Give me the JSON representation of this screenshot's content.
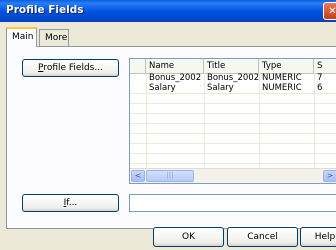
{
  "window": {
    "title": "Profile Fields",
    "close_label": "✕"
  },
  "tabs": [
    {
      "label": "Main",
      "active": true
    },
    {
      "label": "More",
      "active": false
    }
  ],
  "profile_fields_button": {
    "mnemonic": "P",
    "rest": "rofile Fields..."
  },
  "if_button": {
    "mnemonic": "I",
    "rest": "f..."
  },
  "if_field": {
    "value": ""
  },
  "table": {
    "columns": [
      "",
      "Name",
      "Title",
      "Type",
      "S"
    ],
    "rows": [
      {
        "name": "Bonus_2002",
        "title": "Bonus_2002",
        "type": "NUMERIC",
        "s": "7"
      },
      {
        "name": "Salary",
        "title": "Salary",
        "type": "NUMERIC",
        "s": "6"
      }
    ],
    "scroll": {
      "left": "<",
      "right": ">",
      "thumb": "|||"
    }
  },
  "footer": {
    "ok_label": "OK",
    "cancel_label": "Cancel",
    "help_label": "Help"
  }
}
